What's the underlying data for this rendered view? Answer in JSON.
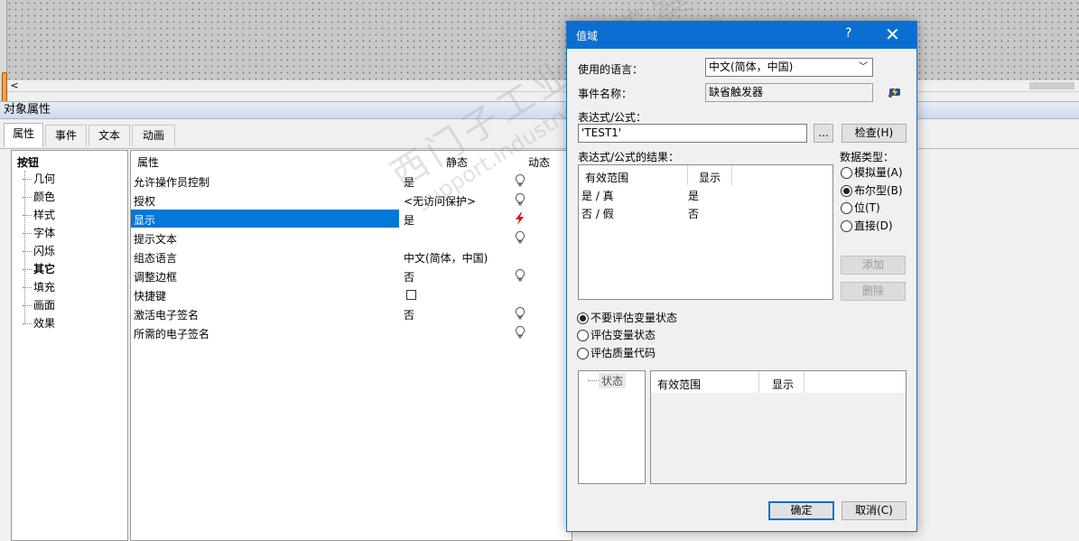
{
  "panel": {
    "title": "对象属性"
  },
  "tabs": [
    "属性",
    "事件",
    "文本",
    "动画"
  ],
  "tree": {
    "root": "按钮",
    "items": [
      "几何",
      "颜色",
      "样式",
      "字体",
      "闪烁",
      "其它",
      "填充",
      "画面",
      "效果"
    ]
  },
  "grid": {
    "headers": {
      "property": "属性",
      "static": "静态",
      "dynamic": "动态"
    },
    "rows": [
      {
        "name": "允许操作员控制",
        "value": "是",
        "dynamic": "bulb"
      },
      {
        "name": "授权",
        "value": "<无访问保护>",
        "dynamic": "bulb"
      },
      {
        "name": "显示",
        "value": "是",
        "dynamic": "lightning",
        "selected": true
      },
      {
        "name": "提示文本",
        "value": "",
        "dynamic": "bulb"
      },
      {
        "name": "组态语言",
        "value": "中文(简体，中国)",
        "dynamic": "none"
      },
      {
        "name": "调整边框",
        "value": "否",
        "dynamic": "bulb"
      },
      {
        "name": "快捷键",
        "value": "",
        "dynamic": "none",
        "checkbox": true
      },
      {
        "name": "激活电子签名",
        "value": "否",
        "dynamic": "bulb"
      },
      {
        "name": "所需的电子签名",
        "value": "",
        "dynamic": "bulb"
      }
    ]
  },
  "dialog": {
    "title": "值域",
    "help": "?",
    "language_label": "使用的语言：",
    "language_value": "中文(简体，中国)",
    "event_label": "事件名称：",
    "event_value": "缺省触发器",
    "expr_label": "表达式/公式：",
    "expr_value": "'TEST1'",
    "ellipsis": "...",
    "check_button": "检查(H)",
    "result_label": "表达式/公式的结果：",
    "result_headers": [
      "有效范围",
      "显示"
    ],
    "result_rows": [
      {
        "range": "是 / 真",
        "display": "是"
      },
      {
        "range": "否 / 假",
        "display": "否"
      }
    ],
    "datatype_label": "数据类型：",
    "datatypes": [
      {
        "label": "模拟量(A)",
        "selected": false
      },
      {
        "label": "布尔型(B)",
        "selected": true
      },
      {
        "label": "位(T)",
        "selected": false
      },
      {
        "label": "直接(D)",
        "selected": false
      }
    ],
    "add_button": "添加",
    "delete_button": "删除",
    "eval_options": [
      {
        "label": "不要评估变量状态",
        "selected": true
      },
      {
        "label": "评估变量状态",
        "selected": false
      },
      {
        "label": "评估质量代码",
        "selected": false
      }
    ],
    "status_label": "状态",
    "bottom_headers": [
      "有效范围",
      "显示"
    ],
    "ok_button": "确定",
    "cancel_button": "取消(C)"
  },
  "watermark": {
    "line1": "西门子工业 找答案",
    "line2": "support.industry.siemens.com/cs"
  },
  "colors": {
    "accent": "#0a6fd0",
    "selection": "#0078d7",
    "lightning": "#e01010"
  }
}
